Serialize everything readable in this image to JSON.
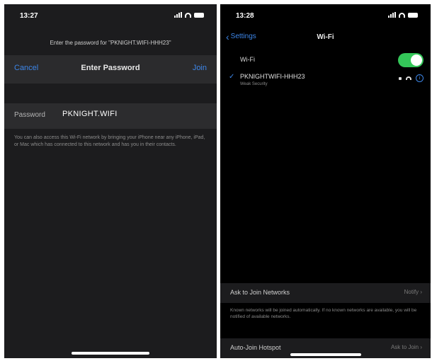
{
  "left": {
    "status": {
      "time": "13:27"
    },
    "prompt": "Enter the password for \"PKNIGHT.WIFI-HHH23\"",
    "nav": {
      "cancel": "Cancel",
      "title": "Enter Password",
      "join": "Join"
    },
    "password": {
      "label": "Password",
      "value": "PKNIGHT.WIFI"
    },
    "hint": "You can also access this Wi-Fi network by bringing your iPhone near any iPhone, iPad, or Mac which has connected to this network and has you in their contacts."
  },
  "right": {
    "status": {
      "time": "13:28"
    },
    "nav": {
      "back": "Settings",
      "title": "Wi-Fi"
    },
    "wifi": {
      "label": "Wi-Fi",
      "on": true
    },
    "network": {
      "name": "PKNIGHTWIFI-HHH23",
      "subtitle": "Weak Security"
    },
    "ask": {
      "label": "Ask to Join Networks",
      "value": "Notify"
    },
    "ask_hint": "Known networks will be joined automatically. If no known networks are available, you will be notified of available networks.",
    "hotspot": {
      "label": "Auto-Join Hotspot",
      "value": "Ask to Join"
    }
  },
  "colors": {
    "accent": "#3d86e8",
    "toggle_on": "#34c759"
  }
}
